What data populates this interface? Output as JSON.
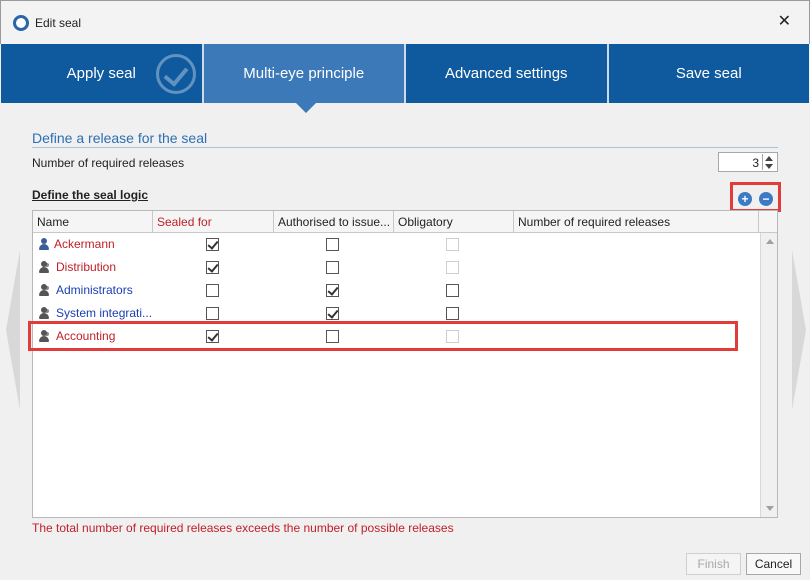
{
  "window": {
    "title": "Edit seal"
  },
  "tabs": [
    {
      "label": "Apply seal"
    },
    {
      "label": "Multi-eye principle"
    },
    {
      "label": "Advanced settings"
    },
    {
      "label": "Save seal"
    }
  ],
  "section": {
    "title": "Define a release for the seal"
  },
  "required_releases": {
    "label": "Number of required releases",
    "value": "3"
  },
  "seal_logic": {
    "label": "Define the seal logic"
  },
  "grid": {
    "columns": [
      "Name",
      "Sealed for",
      "Authorised to issue...",
      "Obligatory",
      "Number of required releases"
    ],
    "rows": [
      {
        "name": "Ackermann",
        "name_color": "red",
        "icon": "user-icon",
        "sealed_for": true,
        "authorised": false,
        "obligatory": false,
        "obligatory_disabled": true
      },
      {
        "name": "Distribution",
        "name_color": "red",
        "icon": "user-group-icon",
        "sealed_for": true,
        "authorised": false,
        "obligatory": false,
        "obligatory_disabled": true
      },
      {
        "name": "Administrators",
        "name_color": "blue",
        "icon": "user-group-icon",
        "sealed_for": false,
        "authorised": true,
        "obligatory": false,
        "obligatory_disabled": false
      },
      {
        "name": "System integrati...",
        "name_color": "blue",
        "icon": "user-group-icon",
        "sealed_for": false,
        "authorised": true,
        "obligatory": false,
        "obligatory_disabled": false
      },
      {
        "name": "Accounting",
        "name_color": "red",
        "icon": "user-group-icon",
        "sealed_for": true,
        "authorised": false,
        "obligatory": false,
        "obligatory_disabled": true
      }
    ]
  },
  "error": {
    "message": "The total number of required releases exceeds the number of possible releases"
  },
  "buttons": {
    "finish": "Finish",
    "cancel": "Cancel"
  },
  "colors": {
    "tab_bg": "#0f5a9e",
    "tab_active_bg": "#3b79b8",
    "section_title": "#2c6fb3",
    "error": "#c0202a",
    "highlight": "#e03c3c"
  }
}
